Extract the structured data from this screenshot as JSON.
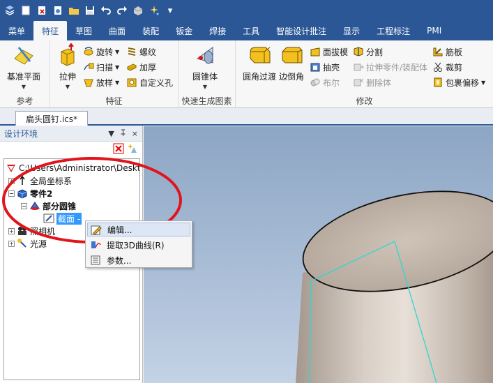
{
  "quick_access": {
    "icons": [
      "logo-icon",
      "new-icon",
      "close-doc-icon",
      "open-icon",
      "folder-icon",
      "save-icon",
      "undo-icon",
      "redo-icon",
      "render-icon",
      "sparkle-icon"
    ],
    "more": "▾"
  },
  "menu": {
    "items": [
      "菜单",
      "特征",
      "草图",
      "曲面",
      "装配",
      "钣金",
      "焊接",
      "工具",
      "智能设计批注",
      "显示",
      "工程标注",
      "PMI"
    ],
    "active_index": 1
  },
  "ribbon": {
    "groups": {
      "reference": {
        "label": "参考",
        "plane_label": "基准平面"
      },
      "feature": {
        "label": "特征",
        "extrude_label": "拉伸",
        "revolve_label": "旋转",
        "sweep_label": "扫描",
        "loft_label": "放样",
        "thread_label": "螺纹",
        "thicken_label": "加厚",
        "custom_hole_label": "自定义孔"
      },
      "quick_gen": {
        "label": "快速生成图素",
        "cone_label": "圆锥体"
      },
      "modify": {
        "label": "修改",
        "fillet_label": "圆角过渡",
        "chamfer_label": "边倒角",
        "draft_label": "面拔模",
        "shell_label": "抽壳",
        "boolean_label": "布尔",
        "split_label": "分割",
        "stretch_label": "拉伸零件/装配体",
        "delete_body_label": "删除体",
        "rib_label": "筋板",
        "trim_label": "裁剪",
        "wrap_label": "包裹偏移"
      }
    }
  },
  "document_tab": {
    "title": "扁头圆钉.ics*"
  },
  "panel": {
    "title": "设计环境",
    "pin": "ᅟ",
    "close": "×"
  },
  "tree": {
    "root_path": "C:\\Users\\Administrator\\Deskt",
    "global_cs": "全局坐标系",
    "part": "零件2",
    "cone": "部分圆锥",
    "section": "截面 -",
    "camera": "照相机",
    "light": "光源"
  },
  "context_menu": {
    "items": [
      {
        "label": "编辑...",
        "icon": "edit-icon"
      },
      {
        "label": "提取3D曲线(R)",
        "icon": "extract-curve-icon"
      },
      {
        "label": "参数...",
        "icon": "params-icon"
      }
    ],
    "highlighted_index": 0
  },
  "colors": {
    "brand": "#2b5797",
    "annotation": "#e0151b",
    "section_line": "#2fd6d0"
  }
}
